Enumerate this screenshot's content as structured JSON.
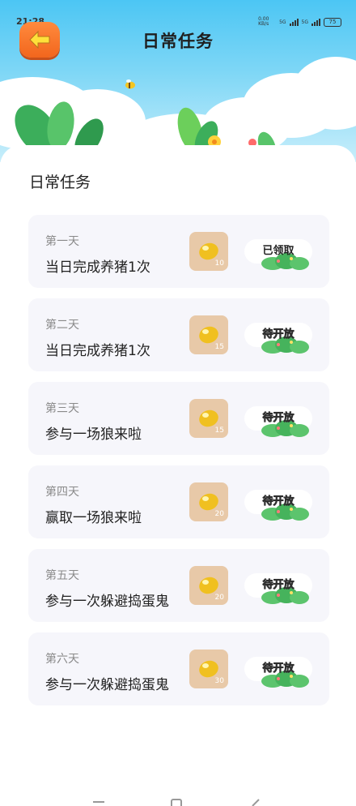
{
  "status_bar": {
    "time": "21:28",
    "net_speed": "0.00 KB/s",
    "network_1": "5G",
    "network_2": "5G",
    "battery": "75"
  },
  "header": {
    "title": "日常任务"
  },
  "section": {
    "title": "日常任务"
  },
  "tasks": [
    {
      "day": "第一天",
      "name": "当日完成养猪1次",
      "reward": "10",
      "status": "已领取"
    },
    {
      "day": "第二天",
      "name": "当日完成养猪1次",
      "reward": "15",
      "status": "待开放"
    },
    {
      "day": "第三天",
      "name": "参与一场狼来啦",
      "reward": "15",
      "status": "待开放"
    },
    {
      "day": "第四天",
      "name": "赢取一场狼来啦",
      "reward": "20",
      "status": "待开放"
    },
    {
      "day": "第五天",
      "name": "参与一次躲避捣蛋鬼",
      "reward": "20",
      "status": "待开放"
    },
    {
      "day": "第六天",
      "name": "参与一次躲避捣蛋鬼",
      "reward": "30",
      "status": "待开放"
    }
  ],
  "colors": {
    "back_button": "#f2661d",
    "card_bg": "#f6f6fb",
    "reward_bg": "#e8c9a8",
    "bean": "#f0c020"
  }
}
